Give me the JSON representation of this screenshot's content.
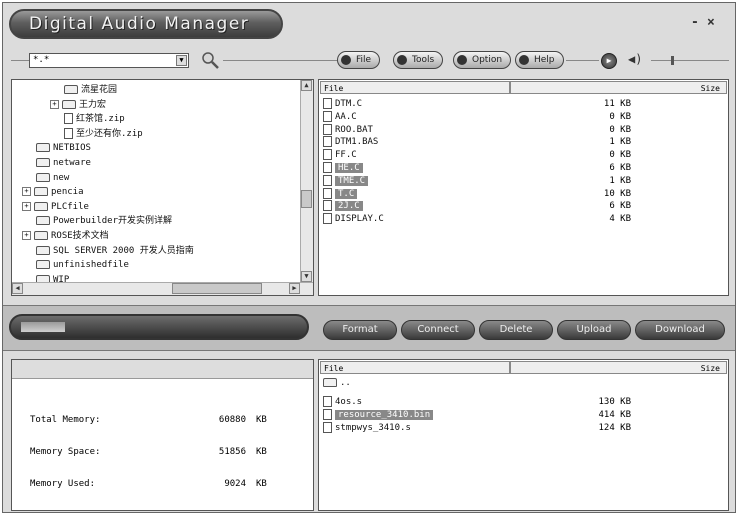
{
  "window": {
    "title": "Digital Audio Manager",
    "minimize": "-",
    "close": "×"
  },
  "toolbar": {
    "filter_value": "*.*",
    "buttons": [
      "File",
      "Tools",
      "Option",
      "Help"
    ]
  },
  "tree": {
    "items": [
      {
        "label": "流星花园",
        "indent": 5,
        "type": "folder",
        "expander": ""
      },
      {
        "label": "王力宏",
        "indent": 4,
        "type": "folder",
        "expander": "+"
      },
      {
        "label": "红茶馆.zip",
        "indent": 5,
        "type": "file",
        "expander": ""
      },
      {
        "label": "至少还有你.zip",
        "indent": 5,
        "type": "file",
        "expander": ""
      },
      {
        "label": "NETBIOS",
        "indent": 3,
        "type": "folder",
        "expander": ""
      },
      {
        "label": "netware",
        "indent": 3,
        "type": "folder",
        "expander": ""
      },
      {
        "label": "new",
        "indent": 3,
        "type": "folder",
        "expander": ""
      },
      {
        "label": "pencia",
        "indent": 2,
        "type": "folder",
        "expander": "+"
      },
      {
        "label": "PLCfile",
        "indent": 2,
        "type": "folder",
        "expander": "+"
      },
      {
        "label": "Powerbuilder开发实例详解",
        "indent": 3,
        "type": "folder",
        "expander": ""
      },
      {
        "label": "ROSE技术文档",
        "indent": 2,
        "type": "folder",
        "expander": "+"
      },
      {
        "label": "SQL SERVER 2000 开发人员指南",
        "indent": 3,
        "type": "folder",
        "expander": ""
      },
      {
        "label": "unfinishedfile",
        "indent": 3,
        "type": "folder",
        "expander": ""
      },
      {
        "label": "WIP",
        "indent": 3,
        "type": "folder",
        "expander": ""
      }
    ]
  },
  "files": {
    "header_file": "File",
    "header_size": "Size",
    "rows": [
      {
        "name": "DTM.C",
        "size": "11 KB",
        "selected": false
      },
      {
        "name": "AA.C",
        "size": "0 KB",
        "selected": false
      },
      {
        "name": "ROO.BAT",
        "size": "0 KB",
        "selected": false
      },
      {
        "name": "DTM1.BAS",
        "size": "1 KB",
        "selected": false
      },
      {
        "name": "FF.C",
        "size": "0 KB",
        "selected": false
      },
      {
        "name": "HE.C",
        "size": "6 KB",
        "selected": true
      },
      {
        "name": "TME.C",
        "size": "1 KB",
        "selected": true
      },
      {
        "name": "T.C",
        "size": "10 KB",
        "selected": true
      },
      {
        "name": "2J.C",
        "size": "6 KB",
        "selected": true
      },
      {
        "name": "DISPLAY.C",
        "size": "4 KB",
        "selected": false
      }
    ]
  },
  "progress": {
    "fraction": 0.16
  },
  "actions": [
    "Format",
    "Connect",
    "Delete",
    "Upload",
    "Download"
  ],
  "memory": {
    "rows": [
      {
        "label": "Total Memory:",
        "value": "60880",
        "unit": "KB"
      },
      {
        "label": "Memory Space:",
        "value": "51856",
        "unit": "KB"
      },
      {
        "label": "Memory Used:",
        "value": "9024",
        "unit": "KB"
      }
    ]
  },
  "device": {
    "header_file": "File",
    "header_size": "Size",
    "parent": "..",
    "rows": [
      {
        "name": "4os.s",
        "size": "130 KB",
        "selected": false
      },
      {
        "name": "resource_3410.bin",
        "size": "414 KB",
        "selected": true
      },
      {
        "name": "stmpwys_3410.s",
        "size": "124 KB",
        "selected": false
      }
    ]
  },
  "colors": {
    "accent": "#3c3c3c",
    "selection": "#888888",
    "panel": "#dcdcdc"
  }
}
